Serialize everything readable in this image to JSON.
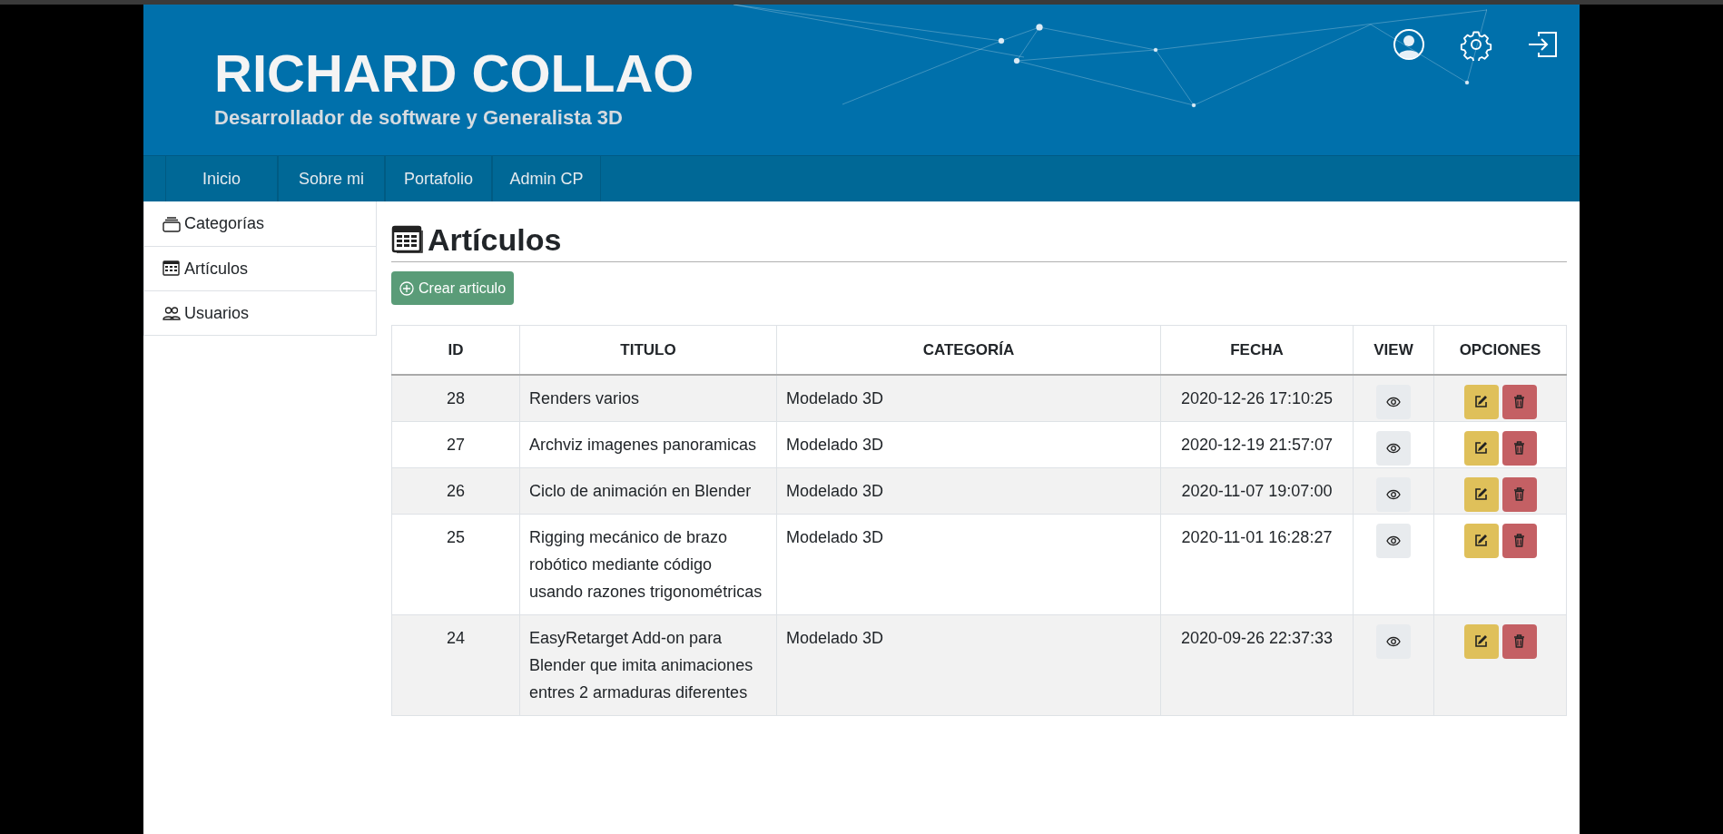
{
  "header": {
    "title": "RICHARD COLLAO",
    "subtitle": "Desarrollador de software y Generalista 3D"
  },
  "nav": [
    "Inicio",
    "Sobre mi",
    "Portafolio",
    "Admin CP"
  ],
  "sidebar": {
    "items": [
      {
        "label": "Categorías"
      },
      {
        "label": "Artículos"
      },
      {
        "label": "Usuarios"
      }
    ]
  },
  "page_title": "Artículos",
  "create_button": "Crear articulo",
  "table": {
    "columns": [
      "ID",
      "TITULO",
      "CATEGORÍA",
      "FECHA",
      "VIEW",
      "OPCIONES"
    ],
    "rows": [
      {
        "id": "28",
        "title": "Renders varios",
        "category": "Modelado 3D",
        "date": "2020-12-26 17:10:25"
      },
      {
        "id": "27",
        "title": "Archviz imagenes panoramicas",
        "category": "Modelado 3D",
        "date": "2020-12-19 21:57:07"
      },
      {
        "id": "26",
        "title": "Ciclo de animación en Blender",
        "category": "Modelado 3D",
        "date": "2020-11-07 19:07:00"
      },
      {
        "id": "25",
        "title": "Rigging mecánico de brazo robótico mediante código usando razones trigonométricas",
        "category": "Modelado 3D",
        "date": "2020-11-01 16:28:27"
      },
      {
        "id": "24",
        "title": "EasyRetarget Add-on para Blender que imita animaciones entres 2 armaduras diferentes",
        "category": "Modelado 3D",
        "date": "2020-09-26 22:37:33"
      }
    ]
  }
}
